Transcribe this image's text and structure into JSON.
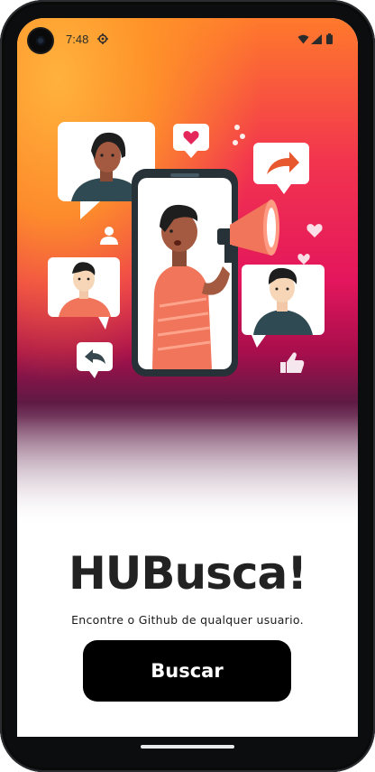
{
  "status_bar": {
    "time": "7:48",
    "icons": [
      "settings-icon",
      "wifi-icon",
      "signal-icon",
      "battery-icon"
    ]
  },
  "hero": {
    "illustration": "person-with-megaphone-on-phone-social-media",
    "colors": {
      "top": "#ffb23d",
      "middle": "#e4165d",
      "bottom": "#5f1a44"
    }
  },
  "main": {
    "title": "HUBusca!",
    "subtitle": "Encontre o Github de qualquer usuario.",
    "search_button_label": "Buscar"
  },
  "colors": {
    "button_bg": "#000000",
    "button_text": "#ffffff",
    "title_text": "#222222"
  }
}
